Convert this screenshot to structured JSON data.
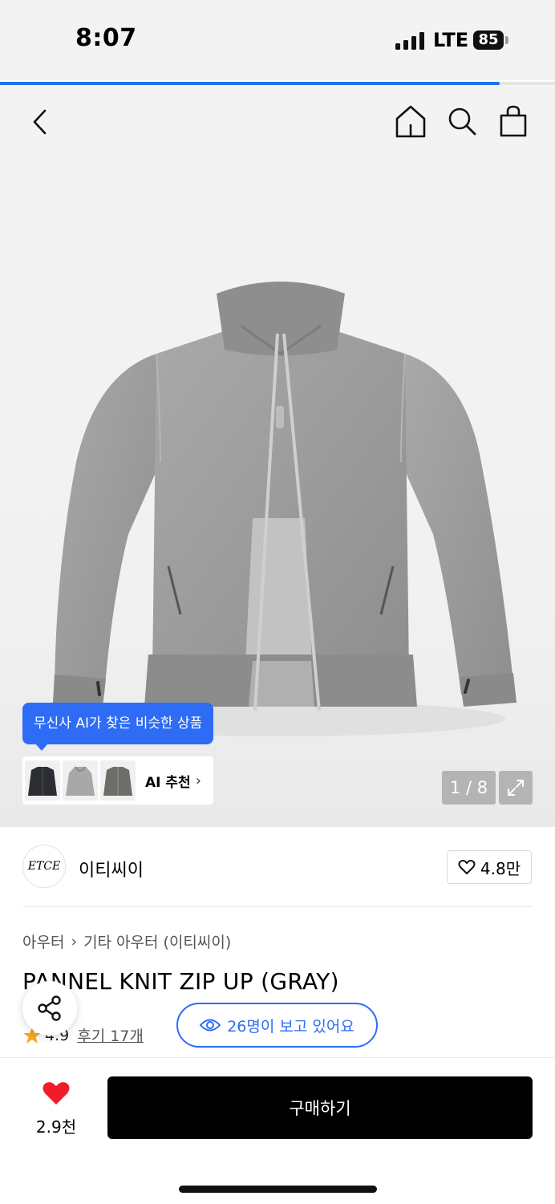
{
  "status_bar": {
    "time": "8:07",
    "network": "LTE",
    "battery": "85"
  },
  "page_load_progress": 0.9,
  "nav": {
    "back_icon": "chevron-left-icon",
    "home_icon": "home-icon",
    "search_icon": "search-icon",
    "cart_icon": "shopping-bag-icon"
  },
  "gallery": {
    "image_alt": "gray knit zip-up jacket",
    "ai_tooltip": "무신사 AI가 찾은 비슷한 상품",
    "ai_label": "AI 추천",
    "counter": "1 / 8"
  },
  "brand": {
    "logo_text": "ETCE",
    "name": "이티씨이",
    "likes": "4.8만"
  },
  "breadcrumb": {
    "category": "아우터",
    "subcategory": "기타 아우터 (이티씨이)"
  },
  "product": {
    "title": "PANNEL KNIT ZIP UP (GRAY)",
    "rating": "4.9",
    "reviews": "후기 17개",
    "viewers": "26명이 보고 있어요"
  },
  "bottom": {
    "wish_count": "2.9천",
    "buy_label": "구매하기"
  },
  "colors": {
    "accent": "#2e6cf6",
    "heart": "#f01c2a",
    "star": "#f5a623"
  }
}
